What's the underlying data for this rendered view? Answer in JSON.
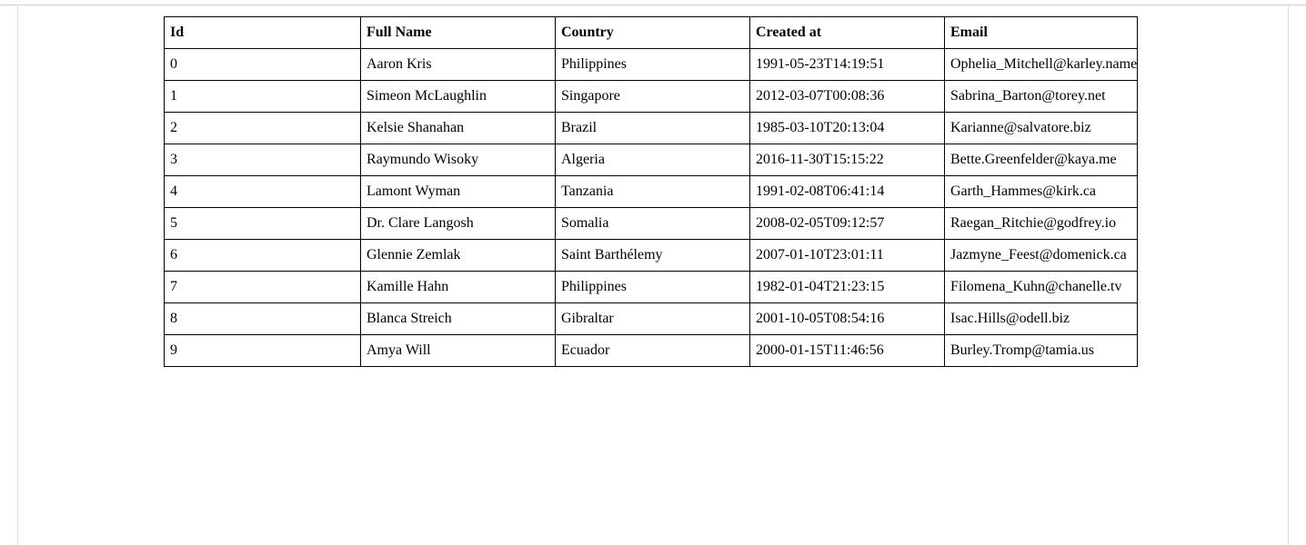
{
  "table": {
    "headers": {
      "id": "Id",
      "full_name": "Full Name",
      "country": "Country",
      "created_at": "Created at",
      "email": "Email"
    },
    "rows": [
      {
        "id": "0",
        "full_name": "Aaron Kris",
        "country": "Philippines",
        "created_at": "1991-05-23T14:19:51",
        "email": "Ophelia_Mitchell@karley.name"
      },
      {
        "id": "1",
        "full_name": "Simeon McLaughlin",
        "country": "Singapore",
        "created_at": "2012-03-07T00:08:36",
        "email": "Sabrina_Barton@torey.net"
      },
      {
        "id": "2",
        "full_name": "Kelsie Shanahan",
        "country": "Brazil",
        "created_at": "1985-03-10T20:13:04",
        "email": "Karianne@salvatore.biz"
      },
      {
        "id": "3",
        "full_name": "Raymundo Wisoky",
        "country": "Algeria",
        "created_at": "2016-11-30T15:15:22",
        "email": "Bette.Greenfelder@kaya.me"
      },
      {
        "id": "4",
        "full_name": "Lamont Wyman",
        "country": "Tanzania",
        "created_at": "1991-02-08T06:41:14",
        "email": "Garth_Hammes@kirk.ca"
      },
      {
        "id": "5",
        "full_name": "Dr. Clare Langosh",
        "country": "Somalia",
        "created_at": "2008-02-05T09:12:57",
        "email": "Raegan_Ritchie@godfrey.io"
      },
      {
        "id": "6",
        "full_name": "Glennie Zemlak",
        "country": "Saint Barthélemy",
        "created_at": "2007-01-10T23:01:11",
        "email": "Jazmyne_Feest@domenick.ca"
      },
      {
        "id": "7",
        "full_name": "Kamille Hahn",
        "country": "Philippines",
        "created_at": "1982-01-04T21:23:15",
        "email": "Filomena_Kuhn@chanelle.tv"
      },
      {
        "id": "8",
        "full_name": "Blanca Streich",
        "country": "Gibraltar",
        "created_at": "2001-10-05T08:54:16",
        "email": "Isac.Hills@odell.biz"
      },
      {
        "id": "9",
        "full_name": "Amya Will",
        "country": "Ecuador",
        "created_at": "2000-01-15T11:46:56",
        "email": "Burley.Tromp@tamia.us"
      }
    ]
  }
}
